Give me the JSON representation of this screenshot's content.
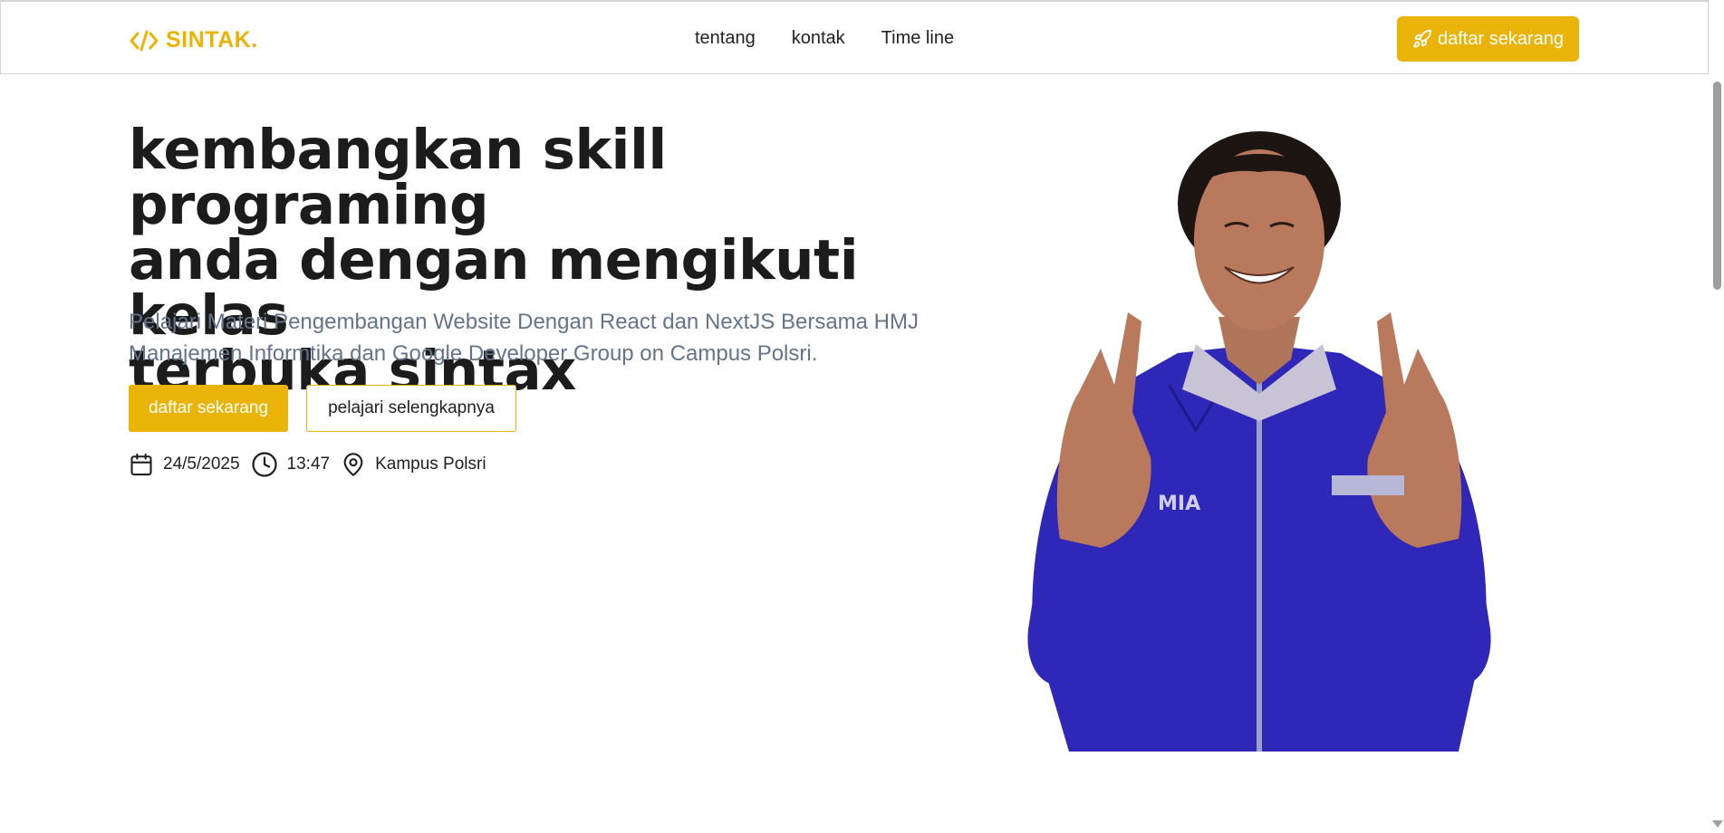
{
  "nav": {
    "logo_text": "SINTAK.",
    "logo_icon": "code-icon",
    "links": [
      "tentang",
      "kontak",
      "Time line"
    ],
    "cta_label": "daftar sekarang",
    "cta_icon": "rocket-icon"
  },
  "hero": {
    "title_lines": [
      "kembangkan skill programing",
      "anda dengan mengikuti kelas",
      "terbuka sintax"
    ],
    "subtitle_lines": [
      "Pelajari Materi Pengembangan Website Dengan React dan NextJS Bersama HMJ",
      "Manajemen Informtika dan Google Developer Group on Campus Polsri."
    ],
    "primary_button": "daftar sekarang",
    "secondary_button": "pelajari selengkapnya",
    "date": "24/5/2025",
    "time": "13:47",
    "location": "Kampus Polsri",
    "shirt_text": "MIA"
  },
  "colors": {
    "accent": "#eab308",
    "subtitle": "#64748b",
    "shirt": "#2f27b8"
  }
}
